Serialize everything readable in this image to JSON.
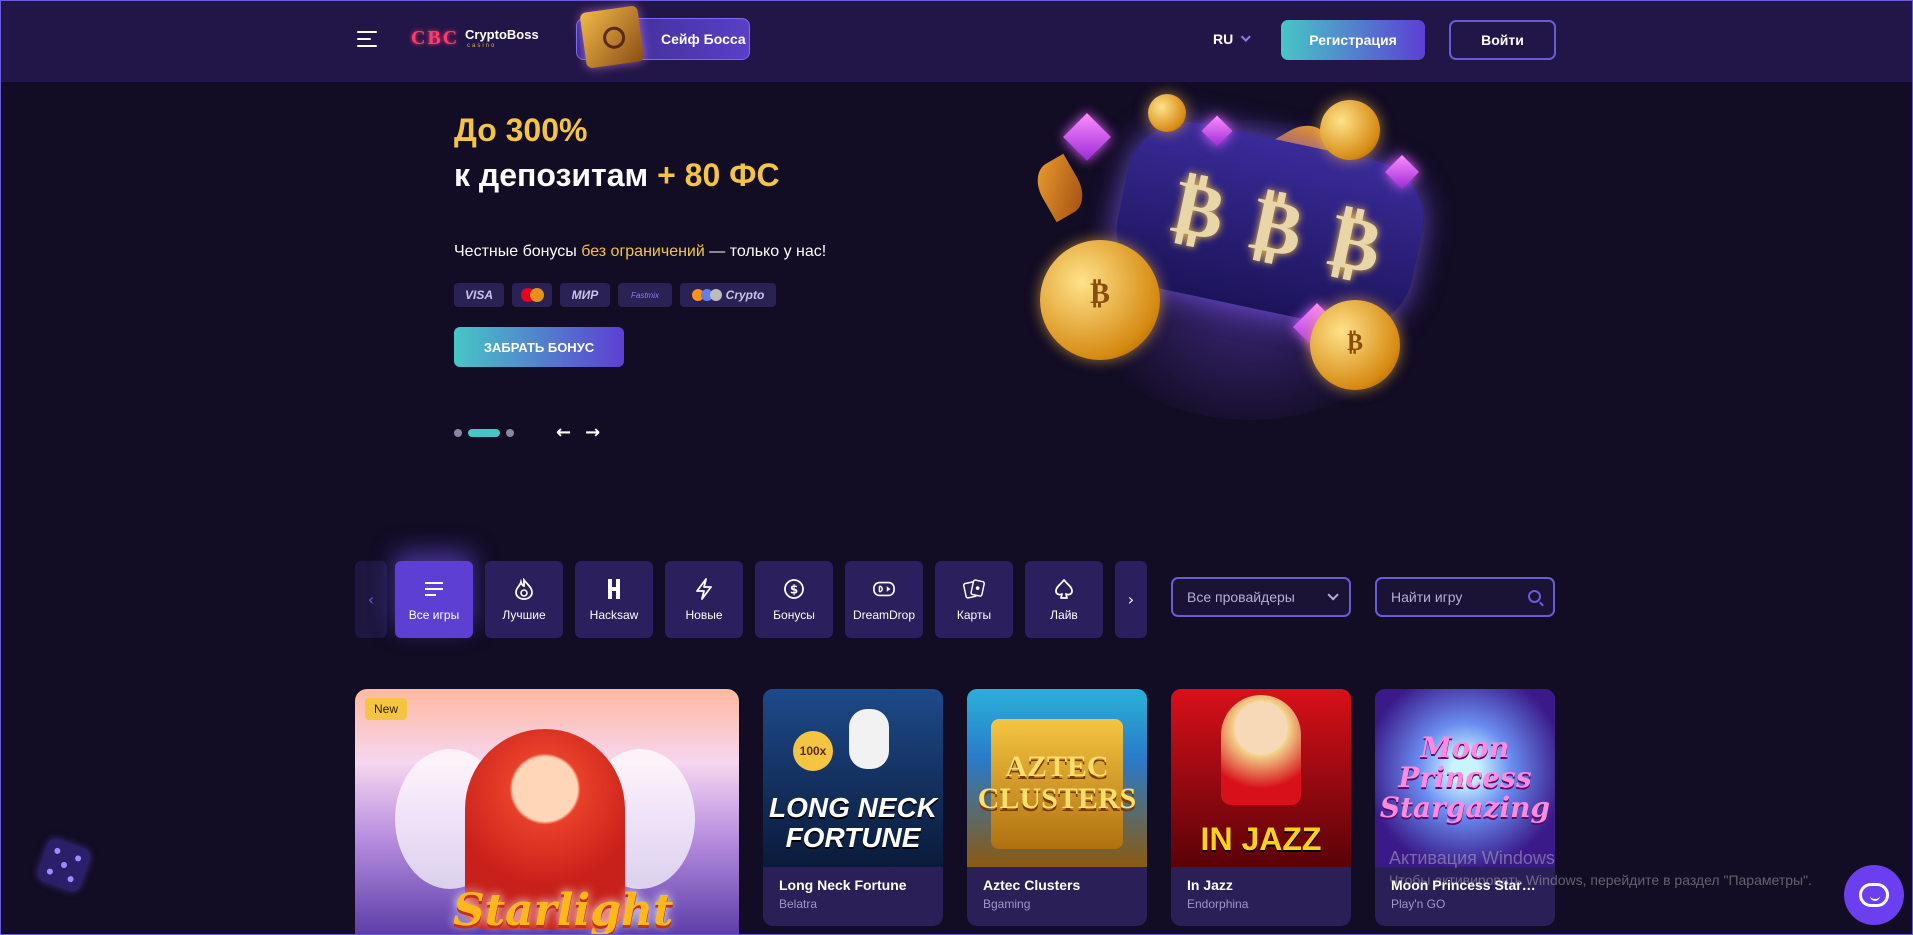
{
  "header": {
    "logo": {
      "letters": "CBC",
      "name": "CryptoBoss",
      "sub": "casino"
    },
    "safe_label": "Сейф Босса",
    "language": "RU",
    "register_label": "Регистрация",
    "login_label": "Войти"
  },
  "hero": {
    "title_line1": "До 300%",
    "title_line2": "к депозитам",
    "title_line2_accent": "+ 80 ФС",
    "desc_before": "Честные бонусы ",
    "desc_accent": "без ограничений",
    "desc_after": " — только у нас!",
    "payments": [
      "VISA",
      "MasterCard",
      "МИР",
      "Fastmix",
      "Crypto"
    ],
    "cta_label": "ЗАБРАТЬ БОНУС",
    "slides": 3,
    "active_slide": 2,
    "prev_arrow": "←",
    "next_arrow": "→",
    "reel_symbols": [
      "₿",
      "₿",
      "₿"
    ]
  },
  "categories": {
    "prev": "‹",
    "next": "›",
    "items": [
      {
        "label": "Все игры",
        "icon": "list-icon",
        "active": true
      },
      {
        "label": "Лучшие",
        "icon": "fire-icon",
        "active": false
      },
      {
        "label": "Hacksaw",
        "icon": "hacksaw-icon",
        "active": false
      },
      {
        "label": "Новые",
        "icon": "lightning-icon",
        "active": false
      },
      {
        "label": "Бонусы",
        "icon": "dollar-coin-icon",
        "active": false
      },
      {
        "label": "DreamDrop",
        "icon": "dreamdrop-icon",
        "active": false
      },
      {
        "label": "Карты",
        "icon": "cards-icon",
        "active": false
      },
      {
        "label": "Лайв",
        "icon": "spade-icon",
        "active": false
      }
    ],
    "providers_placeholder": "Все провайдеры",
    "search_placeholder": "Найти игру"
  },
  "featured": {
    "badge": "New",
    "title": "Starlight"
  },
  "games": [
    {
      "name": "Long Neck Fortune",
      "provider": "Belatra",
      "art_text": "LONG NECK FORTUNE",
      "badge": "100x",
      "colors": [
        "#1e4a8a",
        "#0a1a3a"
      ]
    },
    {
      "name": "Aztec Clusters",
      "provider": "Bgaming",
      "art_text": "AZTEC CLUSTERS",
      "colors": [
        "#2ab0d8",
        "#8a5a10"
      ]
    },
    {
      "name": "In Jazz",
      "provider": "Endorphina",
      "art_text": "IN JAZZ",
      "colors": [
        "#d8101a",
        "#5a0208"
      ]
    },
    {
      "name": "Moon Princess Starg…",
      "provider": "Play'n GO",
      "art_text": "Moon Princess Stargazing",
      "colors": [
        "#5a2ab8",
        "#2a1058"
      ]
    }
  ],
  "watermark": {
    "line1": "Активация Windows",
    "line2": "Чтобы активировать Windows, перейдите в раздел \"Параметры\"."
  }
}
